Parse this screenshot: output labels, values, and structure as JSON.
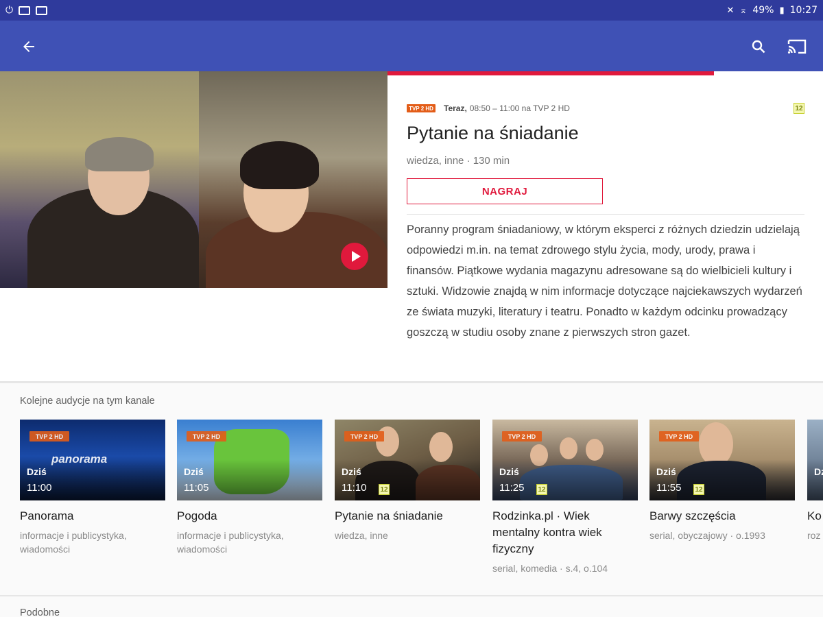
{
  "status_bar": {
    "battery": "49%",
    "time": "10:27",
    "left_icons": [
      "notification-icon",
      "mail-icon",
      "message-icon"
    ],
    "right_icons": [
      "mute-icon",
      "wifi-icon",
      "battery-icon"
    ]
  },
  "app_bar": {
    "color": "#3f51b5",
    "status_color": "#2f3a9c"
  },
  "program": {
    "channel_logo_text": "TVP 2 HD",
    "now_label": "Teraz,",
    "time_range": "08:50 – 11:00 na TVP 2 HD",
    "age_rating": "12",
    "title": "Pytanie na śniadanie",
    "subtitle": "wiedza, inne · 130 min",
    "record_label": "NAGRAJ",
    "progress": 0.75,
    "description": "Poranny program śniadaniowy, w którym eksperci z różnych dziedzin udzielają odpowiedzi m.in. na temat zdrowego stylu życia, mody, urody, prawa i finansów. Piątkowe wydania magazynu adresowane są do wielbicieli kultury i sztuki. Widzowie znajdą w nim informacje dotyczące najciekawszych wydarzeń ze świata muzyki, literatury i teatru. Ponadto w każdym odcinku prowadzący goszczą w studiu osoby znane z pierwszych stron gazet."
  },
  "accent_color": "#e0193c",
  "next_section": {
    "title": "Kolejne audycje na tym kanale",
    "cards": [
      {
        "day": "Dziś",
        "time": "11:00",
        "title": "Panorama",
        "genre": "informacje i publicystyka, wiadomości",
        "age": "",
        "thumb_text": "panorama",
        "logo": "TVP 2 HD"
      },
      {
        "day": "Dziś",
        "time": "11:05",
        "title": "Pogoda",
        "genre": "informacje i publicystyka, wiadomości",
        "age": "",
        "logo": "TVP 2 HD"
      },
      {
        "day": "Dziś",
        "time": "11:10",
        "title": "Pytanie na śniadanie",
        "genre": "wiedza, inne",
        "age": "12",
        "logo": "TVP 2 HD"
      },
      {
        "day": "Dziś",
        "time": "11:25",
        "title": "Rodzinka.pl · Wiek mentalny kontra wiek fizyczny",
        "genre": "serial, komedia · s.4, o.104",
        "age": "12",
        "logo": "TVP 2 HD"
      },
      {
        "day": "Dziś",
        "time": "11:55",
        "title": "Barwy szczęścia",
        "genre": "serial, obyczajowy · o.1993",
        "age": "12",
        "logo": "TVP 2 HD"
      },
      {
        "day": "Dziś",
        "time": "",
        "title": "Ko",
        "genre": "roz",
        "age": "",
        "logo": ""
      }
    ]
  },
  "similar_section": {
    "title": "Podobne"
  }
}
